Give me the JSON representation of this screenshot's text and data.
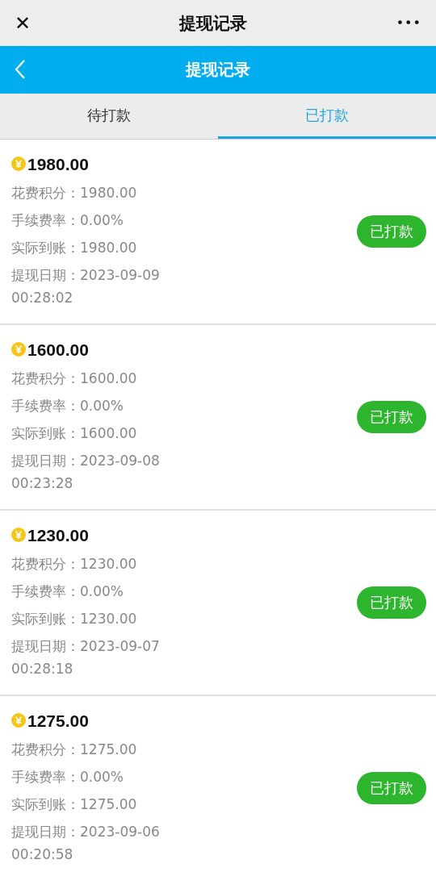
{
  "top_bar": {
    "close": "✕",
    "title": "提现记录",
    "more": "•••"
  },
  "header": {
    "title": "提现记录"
  },
  "tabs": [
    {
      "label": "待打款",
      "selected": false
    },
    {
      "label": "已打款",
      "selected": true
    }
  ],
  "records": [
    {
      "amount": "1980.00",
      "rows": [
        {
          "label": "花费积分：",
          "value": "1980.00"
        },
        {
          "label": "手续费率：",
          "value": "0.00%"
        },
        {
          "label": "实际到账：",
          "value": "1980.00"
        },
        {
          "label": "提现日期：",
          "value": "2023-09-09 00:28:02"
        }
      ],
      "status": "已打款"
    },
    {
      "amount": "1600.00",
      "rows": [
        {
          "label": "花费积分：",
          "value": "1600.00"
        },
        {
          "label": "手续费率：",
          "value": "0.00%"
        },
        {
          "label": "实际到账：",
          "value": "1600.00"
        },
        {
          "label": "提现日期：",
          "value": "2023-09-08 00:23:28"
        }
      ],
      "status": "已打款"
    },
    {
      "amount": "1230.00",
      "rows": [
        {
          "label": "花费积分：",
          "value": "1230.00"
        },
        {
          "label": "手续费率：",
          "value": "0.00%"
        },
        {
          "label": "实际到账：",
          "value": "1230.00"
        },
        {
          "label": "提现日期：",
          "value": "2023-09-07 00:28:18"
        }
      ],
      "status": "已打款"
    },
    {
      "amount": "1275.00",
      "rows": [
        {
          "label": "花费积分：",
          "value": "1275.00"
        },
        {
          "label": "手续费率：",
          "value": "0.00%"
        },
        {
          "label": "实际到账：",
          "value": "1275.00"
        },
        {
          "label": "提现日期：",
          "value": "2023-09-06 00:20:58"
        }
      ],
      "status": "已打款"
    }
  ]
}
